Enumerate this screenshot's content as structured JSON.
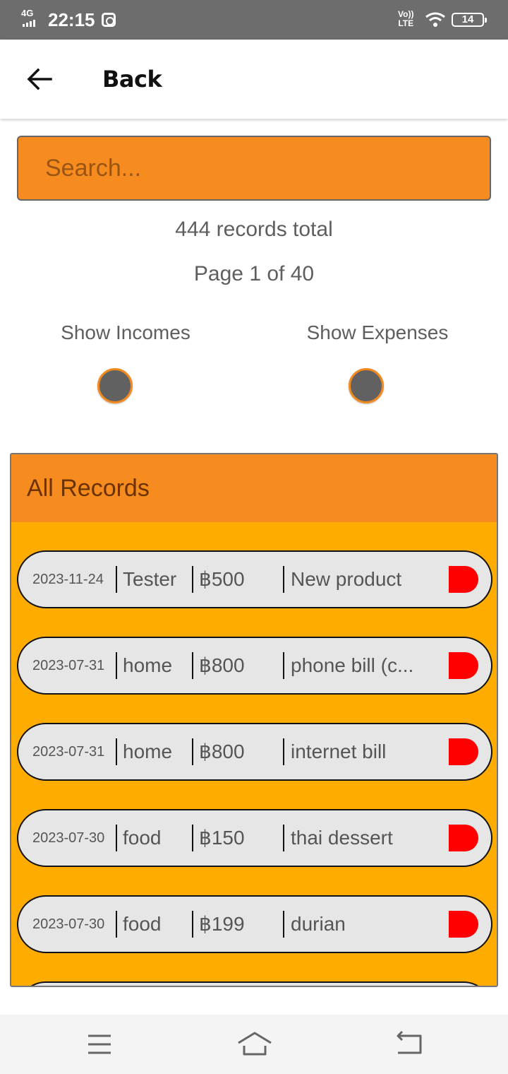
{
  "status_bar": {
    "network": "4G",
    "time": "22:15",
    "volte_top": "Vo))",
    "volte_bottom": "LTE",
    "battery": "14"
  },
  "app_bar": {
    "back_icon": "arrow-left-icon",
    "title": "Back"
  },
  "search": {
    "placeholder": "Search..."
  },
  "summary": {
    "total": "444 records total",
    "page": "Page 1 of 40"
  },
  "filters": {
    "incomes_label": "Show Incomes",
    "expenses_label": "Show Expenses"
  },
  "records": {
    "title": "All Records",
    "items": [
      {
        "date": "2023-11-24",
        "category": "Tester",
        "amount": "฿500",
        "description": "New product"
      },
      {
        "date": "2023-07-31",
        "category": "home",
        "amount": "฿800",
        "description": "phone bill (c..."
      },
      {
        "date": "2023-07-31",
        "category": "home",
        "amount": "฿800",
        "description": "internet bill"
      },
      {
        "date": "2023-07-30",
        "category": "food",
        "amount": "฿150",
        "description": "thai dessert"
      },
      {
        "date": "2023-07-30",
        "category": "food",
        "amount": "฿199",
        "description": "durian"
      }
    ]
  },
  "colors": {
    "accent_orange": "#f68c1f",
    "panel_background": "#fead00",
    "expense_indicator": "#ff0000",
    "status_bar": "#6d6d6d"
  },
  "nav_bar": {
    "icons": [
      "menu-icon",
      "home-icon",
      "back-icon"
    ]
  }
}
